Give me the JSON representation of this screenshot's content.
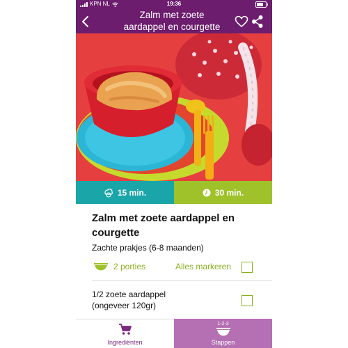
{
  "status_bar": {
    "carrier": "KPN NL",
    "time": "19:36"
  },
  "header": {
    "title_line1": "Zalm met zoete",
    "title_line2": "aardappel en courgette"
  },
  "times": {
    "prep": "15 min.",
    "cook": "30 min."
  },
  "recipe": {
    "title": "Zalm met zoete aardappel en courgette",
    "subtitle": "Zachte prakjes (6-8 maanden)",
    "portions": "2  porties",
    "mark_all": "Alles markeren"
  },
  "ingredients": [
    {
      "line1": "1/2  zoete aardappel",
      "line2": "(ongeveer 120gr)"
    }
  ],
  "tabs": {
    "ingredients": "Ingrediënten",
    "steps": "Stappen",
    "steps_mini": "1-2-3"
  },
  "colors": {
    "header": "#6c1d6e",
    "prep": "#1aa6a8",
    "cook": "#9fc22b",
    "accent_green": "#8aae1e",
    "steps_tab": "#b56fb3"
  }
}
